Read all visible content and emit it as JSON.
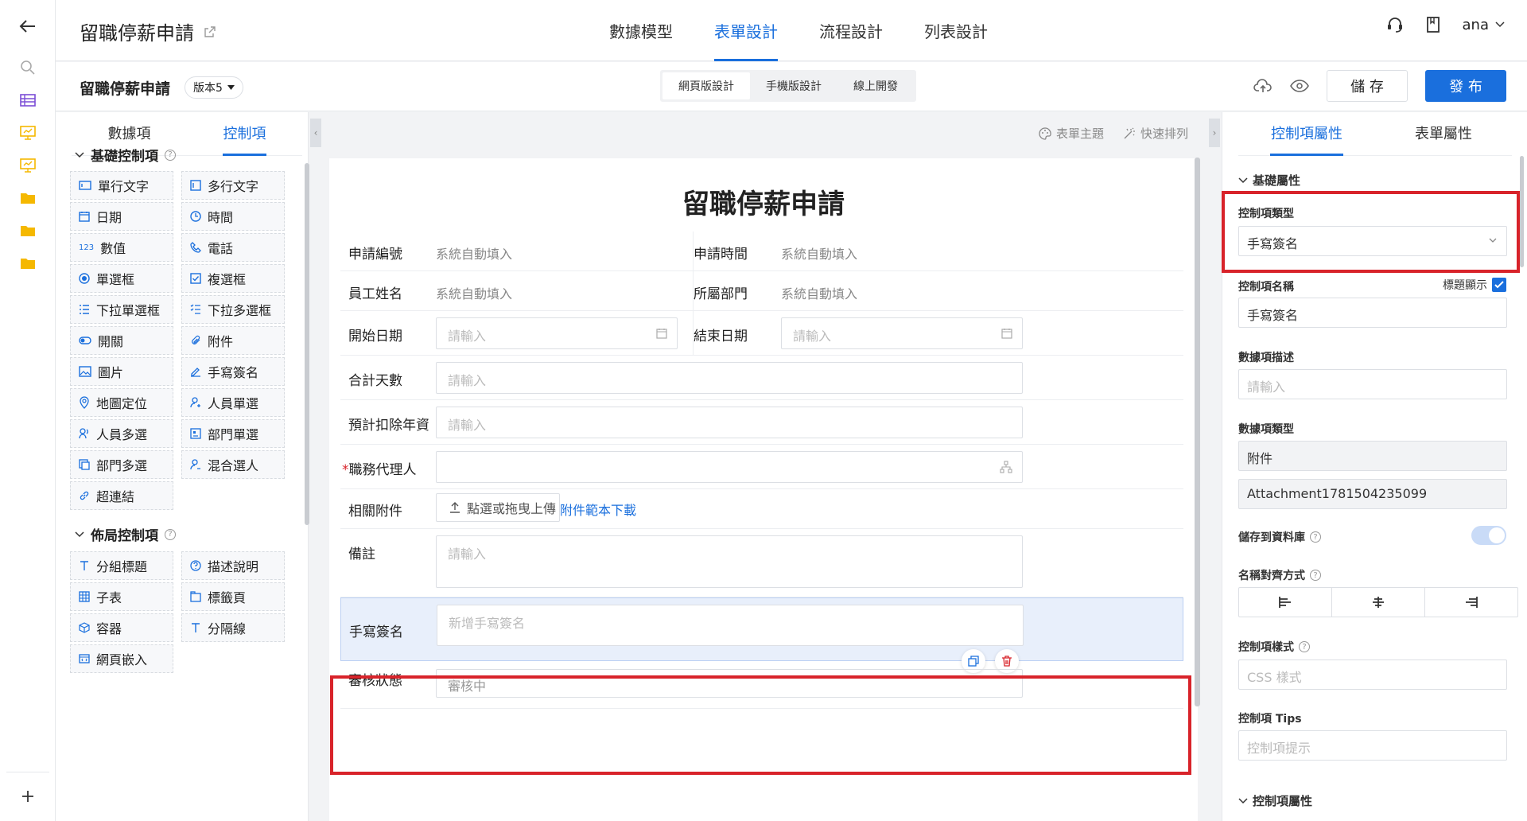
{
  "header": {
    "title": "留職停薪申請",
    "tabs": [
      {
        "label": "數據模型",
        "active": false
      },
      {
        "label": "表單設計",
        "active": true
      },
      {
        "label": "流程設計",
        "active": false
      },
      {
        "label": "列表設計",
        "active": false
      }
    ],
    "user": "ana"
  },
  "toolbar": {
    "form_title": "留職停薪申請",
    "version": "版本5",
    "modes": [
      "網頁版設計",
      "手機版設計",
      "線上開發"
    ],
    "save_label": "儲 存",
    "publish_label": "發 布"
  },
  "left_panel": {
    "tabs": [
      "數據項",
      "控制項"
    ],
    "active_tab": "控制項",
    "basic_section": "基礎控制項",
    "basic_controls": [
      "單行文字",
      "多行文字",
      "日期",
      "時間",
      "數值",
      "電話",
      "單選框",
      "複選框",
      "下拉單選框",
      "下拉多選框",
      "開關",
      "附件",
      "圖片",
      "手寫簽名",
      "地圖定位",
      "人員單選",
      "人員多選",
      "部門單選",
      "部門多選",
      "混合選人",
      "超連結"
    ],
    "layout_section": "佈局控制項",
    "layout_controls": [
      "分組標題",
      "描述說明",
      "子表",
      "標籤頁",
      "容器",
      "分隔線",
      "網頁嵌入"
    ]
  },
  "canvas": {
    "tools": [
      "表單主題",
      "快速排列"
    ],
    "form_title": "留職停薪申請",
    "fields": {
      "apply_no_label": "申請編號",
      "apply_no_value": "系統自動填入",
      "apply_time_label": "申請時間",
      "apply_time_value": "系統自動填入",
      "emp_name_label": "員工姓名",
      "emp_name_value": "系統自動填入",
      "dept_label": "所屬部門",
      "dept_value": "系統自動填入",
      "start_label": "開始日期",
      "start_ph": "請輸入",
      "end_label": "結束日期",
      "end_ph": "請輸入",
      "total_label": "合計天數",
      "total_ph": "請輸入",
      "deduct_label": "預計扣除年資",
      "deduct_ph": "請輸入",
      "agent_required": "*",
      "agent_label": "職務代理人",
      "attach_label": "相關附件",
      "upload_label": "點選或拖曳上傳",
      "template_link": "附件範本下載",
      "note_label": "備註",
      "note_ph": "請輸入",
      "sign_label": "手寫簽名",
      "sign_ph": "新增手寫簽名",
      "status_label": "審核狀態",
      "status_value": "審核中"
    }
  },
  "right_panel": {
    "tabs": [
      "控制項屬性",
      "表單屬性"
    ],
    "active_tab": "控制項屬性",
    "basic_section": "基礎屬性",
    "control_type_label": "控制項類型",
    "control_type_value": "手寫簽名",
    "control_name_label": "控制項名稱",
    "show_title_label": "標題顯示",
    "control_name_value": "手寫簽名",
    "data_desc_label": "數據項描述",
    "data_desc_ph": "請輸入",
    "data_type_label": "數據項類型",
    "data_type_value": "附件",
    "data_code": "Attachment1781504235099",
    "save_db_label": "儲存到資料庫",
    "align_label": "名稱對齊方式",
    "style_label": "控制項樣式",
    "style_ph": "CSS 樣式",
    "tips_label": "控制項 Tips",
    "tips_ph": "控制項提示",
    "control_section": "控制項屬性"
  },
  "colors": {
    "accent": "#1a6fdd",
    "highlight": "#d8232a",
    "selected_bg": "#e8effb",
    "folder": "#f5b800"
  }
}
